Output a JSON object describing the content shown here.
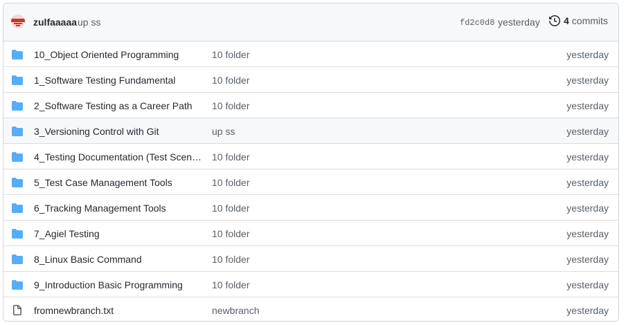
{
  "latest_commit": {
    "author": "zulfaaaaa",
    "message": "up ss",
    "hash": "fd2c0d8",
    "time": "yesterday",
    "commit_count": "4",
    "commit_word": "commits"
  },
  "colors": {
    "folder": "#54aeff",
    "file": "#57606a",
    "avatar_accent": "#c0392b"
  },
  "files": [
    {
      "name": "10_Object Oriented Programming",
      "message": "10 folder",
      "time": "yesterday",
      "type": "folder"
    },
    {
      "name": "1_Software Testing Fundamental",
      "message": "10 folder",
      "time": "yesterday",
      "type": "folder"
    },
    {
      "name": "2_Software Testing as a Career Path",
      "message": "10 folder",
      "time": "yesterday",
      "type": "folder"
    },
    {
      "name": "3_Versioning Control with Git",
      "message": "up ss",
      "time": "yesterday",
      "type": "folder"
    },
    {
      "name": "4_Testing Documentation (Test Scena...",
      "message": "10 folder",
      "time": "yesterday",
      "type": "folder"
    },
    {
      "name": "5_Test Case Management Tools",
      "message": "10 folder",
      "time": "yesterday",
      "type": "folder"
    },
    {
      "name": "6_Tracking Management Tools",
      "message": "10 folder",
      "time": "yesterday",
      "type": "folder"
    },
    {
      "name": "7_Agiel Testing",
      "message": "10 folder",
      "time": "yesterday",
      "type": "folder"
    },
    {
      "name": "8_Linux Basic Command",
      "message": "10 folder",
      "time": "yesterday",
      "type": "folder"
    },
    {
      "name": "9_Introduction Basic Programming",
      "message": "10 folder",
      "time": "yesterday",
      "type": "folder"
    },
    {
      "name": "fromnewbranch.txt",
      "message": "newbranch",
      "time": "yesterday",
      "type": "file"
    }
  ]
}
